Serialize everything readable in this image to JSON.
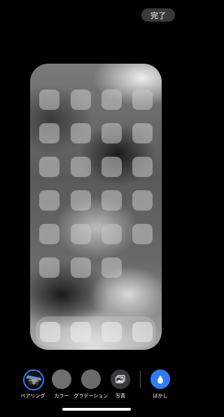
{
  "header": {
    "done_label": "完了"
  },
  "options": [
    {
      "label": "ペアリング",
      "icon": "paired-photo-icon",
      "selected": true
    },
    {
      "label": "カラー",
      "icon": "gray-swatch-icon"
    },
    {
      "label": "グラデーション",
      "icon": "gray-swatch-icon"
    },
    {
      "label": "写真",
      "icon": "photos-icon"
    },
    {
      "label": "ぼかし",
      "icon": "water-drop-icon",
      "accent": "#2f7cf6"
    }
  ],
  "colors": {
    "accent": "#2f7cf6",
    "background": "#000000",
    "done_button": "#3a3a3c"
  }
}
